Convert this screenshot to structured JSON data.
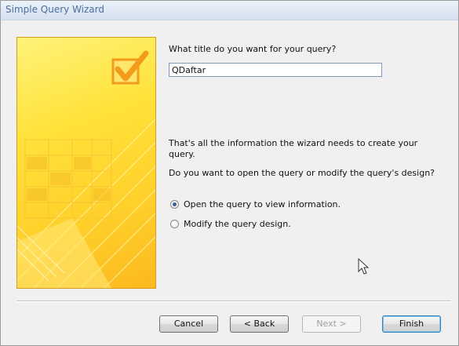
{
  "window": {
    "title": "Simple Query Wizard"
  },
  "form": {
    "question": "What title do you want for your query?",
    "title_value": "QDaftar",
    "info_text": "That's all the information the wizard needs to create your query.",
    "choice_prompt": "Do you want to open the query or modify the query's design?",
    "options": [
      {
        "label": "Open the query to view information.",
        "selected": true
      },
      {
        "label": "Modify the query design.",
        "selected": false
      }
    ]
  },
  "buttons": {
    "cancel": "Cancel",
    "back": "< Back",
    "next": "Next >",
    "finish": "Finish"
  },
  "icons": {
    "wizard_art": "checkbox-check-icon",
    "cursor": "mouse-pointer-icon"
  },
  "colors": {
    "panel_yellow": "#ffd52e",
    "panel_border": "#d69b1c",
    "title_blue": "#4b6e9c",
    "radio_dot": "#3a5e9b",
    "check_orange": "#f29b1c"
  }
}
